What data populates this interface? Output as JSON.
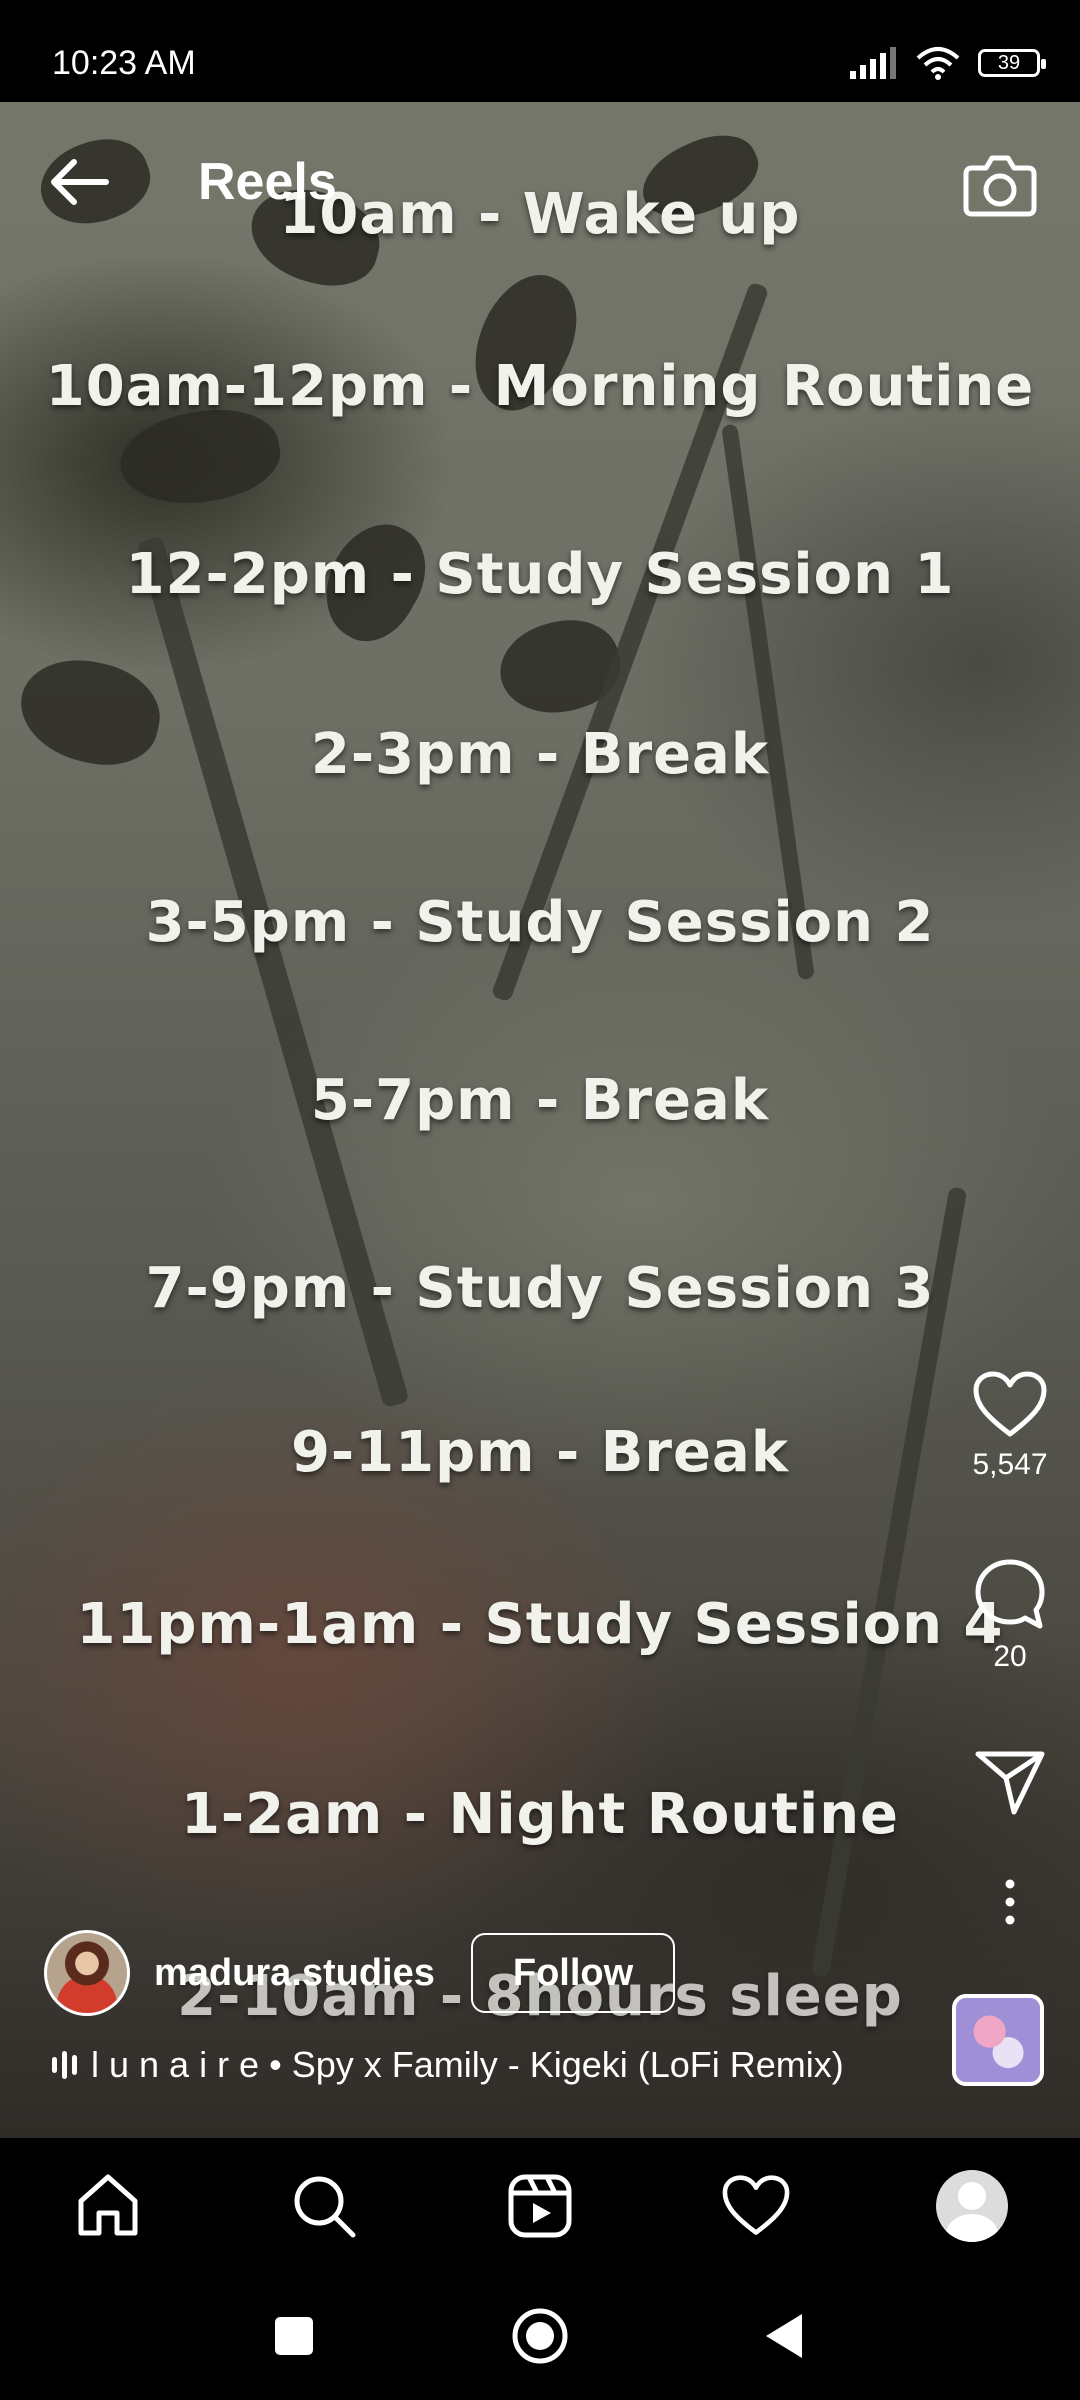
{
  "status_bar": {
    "time": "10:23 AM",
    "battery": "39"
  },
  "header": {
    "title": "Reels"
  },
  "reel": {
    "schedule": [
      "10am - Wake up",
      "10am-12pm  - Morning Routine",
      "12-2pm  - Study Session 1",
      "2-3pm  - Break",
      "3-5pm  - Study Session 2",
      "5-7pm  - Break",
      "7-9pm  - Study Session 3",
      "9-11pm  - Break",
      "11pm-1am  - Study Session 4",
      "1-2am  - Night Routine",
      "2-10am  - 8hours sleep"
    ],
    "likes": "5,547",
    "comments": "20",
    "author": {
      "username": "madura.studies",
      "follow_label": "Follow"
    },
    "audio": {
      "text": "l u n a i r e • Spy x Family - Kigeki (LoFi Remix)"
    }
  },
  "icons": {
    "back": "arrow-left-icon",
    "camera": "camera-icon",
    "like": "heart-icon",
    "comment": "comment-icon",
    "share": "send-icon",
    "more": "more-vertical-icon",
    "nav": [
      "home-icon",
      "search-icon",
      "reels-icon",
      "heart-icon",
      "profile-avatar"
    ]
  }
}
